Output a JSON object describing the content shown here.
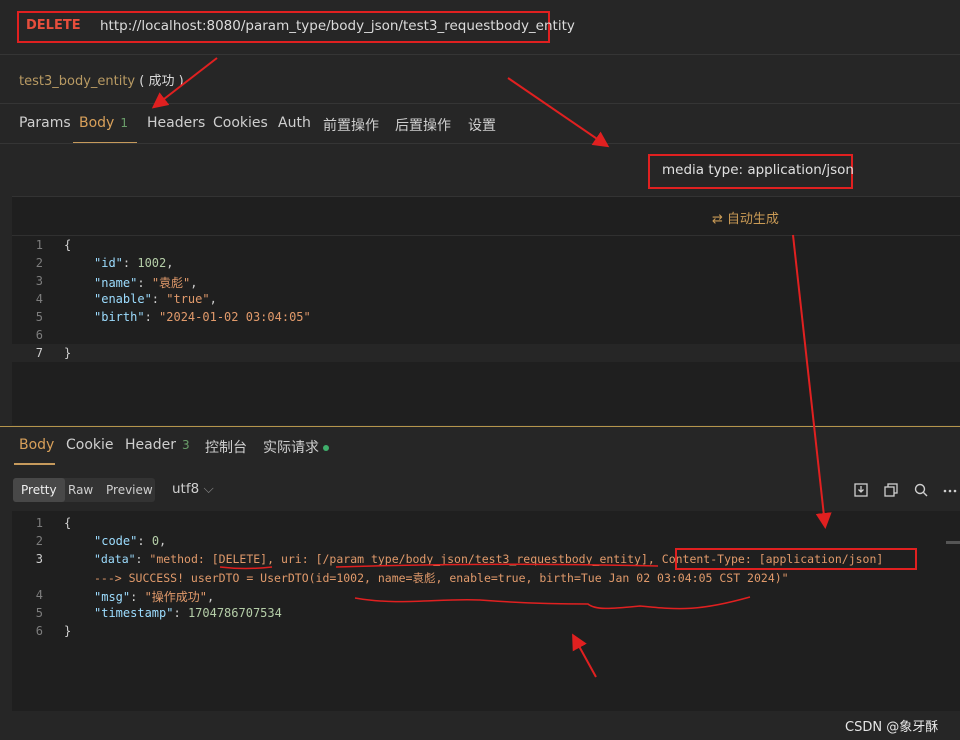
{
  "request": {
    "method": "DELETE",
    "url": "http://localhost:8080/param_type/body_json/test3_requestbody_entity",
    "name": "test3_body_entity",
    "status": "( 成功 )"
  },
  "request_tabs": [
    {
      "label": "Params"
    },
    {
      "label": "Body",
      "badge": "1"
    },
    {
      "label": "Headers"
    },
    {
      "label": "Cookies"
    },
    {
      "label": "Auth"
    },
    {
      "label": "前置操作"
    },
    {
      "label": "后置操作"
    },
    {
      "label": "设置"
    }
  ],
  "media_type": "media type: application/json",
  "auto_generate": "自动生成",
  "request_body": {
    "line_numbers": [
      "1",
      "2",
      "3",
      "4",
      "5",
      "6",
      "7"
    ],
    "lines": {
      "l1": "{",
      "l2_key": "\"id\"",
      "l2_val": "1002",
      "l3_key": "\"name\"",
      "l3_val": "\"袁彪\"",
      "l4_key": "\"enable\"",
      "l4_val": "\"true\"",
      "l5_key": "\"birth\"",
      "l5_val": "\"2024-01-02 03:04:05\"",
      "l7": "}"
    }
  },
  "response_tabs": [
    {
      "label": "Body"
    },
    {
      "label": "Cookie"
    },
    {
      "label": "Header",
      "badge": "3"
    },
    {
      "label": "控制台"
    },
    {
      "label": "实际请求"
    }
  ],
  "view_modes": [
    "Pretty",
    "Raw",
    "Preview"
  ],
  "encoding": "utf8",
  "response_body": {
    "line_numbers": [
      "1",
      "2",
      "3",
      "",
      "4",
      "5",
      "6"
    ],
    "l1": "{",
    "code_key": "\"code\"",
    "code_val": "0",
    "data_key": "\"data\"",
    "data_val_1": "\"method: [DELETE], uri: [/param_type/body_json/test3_requestbody_entity], ",
    "data_val_ct": "Content-Type: [application/json]",
    "data_val_2": "---> SUCCESS! userDTO = UserDTO(id=1002, name=袁彪, enable=true, birth=Tue Jan 02 03:04:05 CST 2024)\"",
    "msg_key": "\"msg\"",
    "msg_val": "\"操作成功\"",
    "ts_key": "\"timestamp\"",
    "ts_val": "1704786707534",
    "l6": "}"
  },
  "toolbar_icons": [
    "download-icon",
    "copy-icon",
    "search-icon",
    "more-icon"
  ],
  "watermark": "CSDN @象牙酥",
  "colors": {
    "annotation": "#e02020",
    "accent": "#d8a05a",
    "string": "#e19a6b",
    "key": "#9cdcfe"
  }
}
